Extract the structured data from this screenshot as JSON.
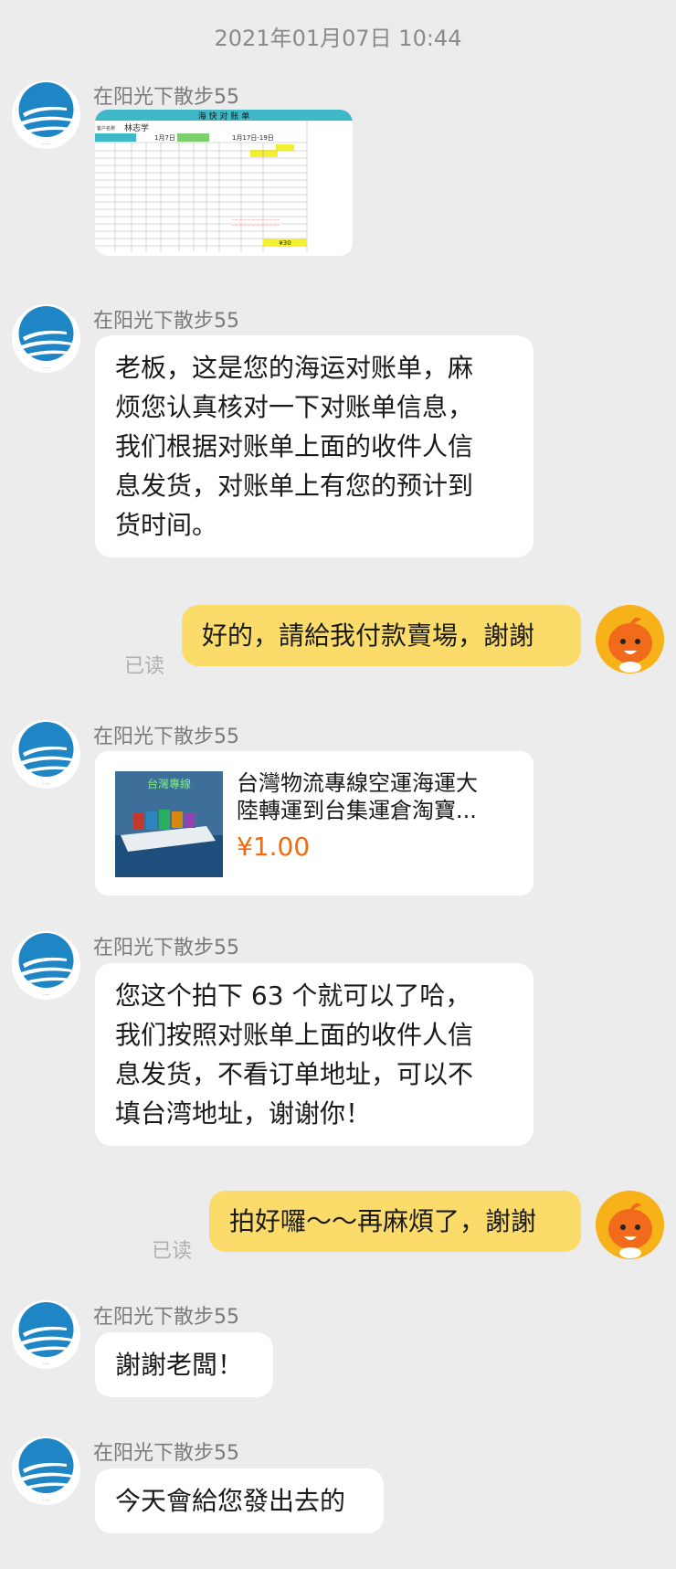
{
  "timestamp": "2021年01月07日 10:44",
  "contact_name": "在阳光下散步55",
  "statement_image": {
    "title": "海 快 对 账 单",
    "customer_label": "客户名称",
    "customer_name": "林志学",
    "date": "1月7日",
    "arrival": "1月17日-19日",
    "amount": "¥30"
  },
  "messages": {
    "m2": [
      "老板，这是您的海运对账单，麻",
      "烦您认真核对一下对账单信息，",
      "我们根据对账单上面的收件人信",
      "息发货，对账单上有您的预计到",
      "货时间。"
    ],
    "m3": "好的，請給我付款賣場，謝謝",
    "m5": [
      "您这个拍下  63 个就可以了哈，",
      "我们按照对账单上面的收件人信",
      "息发货，不看订单地址，可以不",
      "填台湾地址，谢谢你！"
    ],
    "m6": "拍好囉～～再麻煩了，謝謝",
    "m7": "謝謝老闆！",
    "m8": "今天會給您發出去的"
  },
  "read_label": "已读",
  "product": {
    "title_line1": "台灣物流專線空運海運大",
    "title_line2": "陸轉運到台集運倉淘寶...",
    "price": "¥1.00",
    "thumb_text": "台灣專線"
  },
  "colors": {
    "background": "#ececec",
    "outgoing_bubble": "#fbdc6a",
    "price": "#f06a10"
  }
}
